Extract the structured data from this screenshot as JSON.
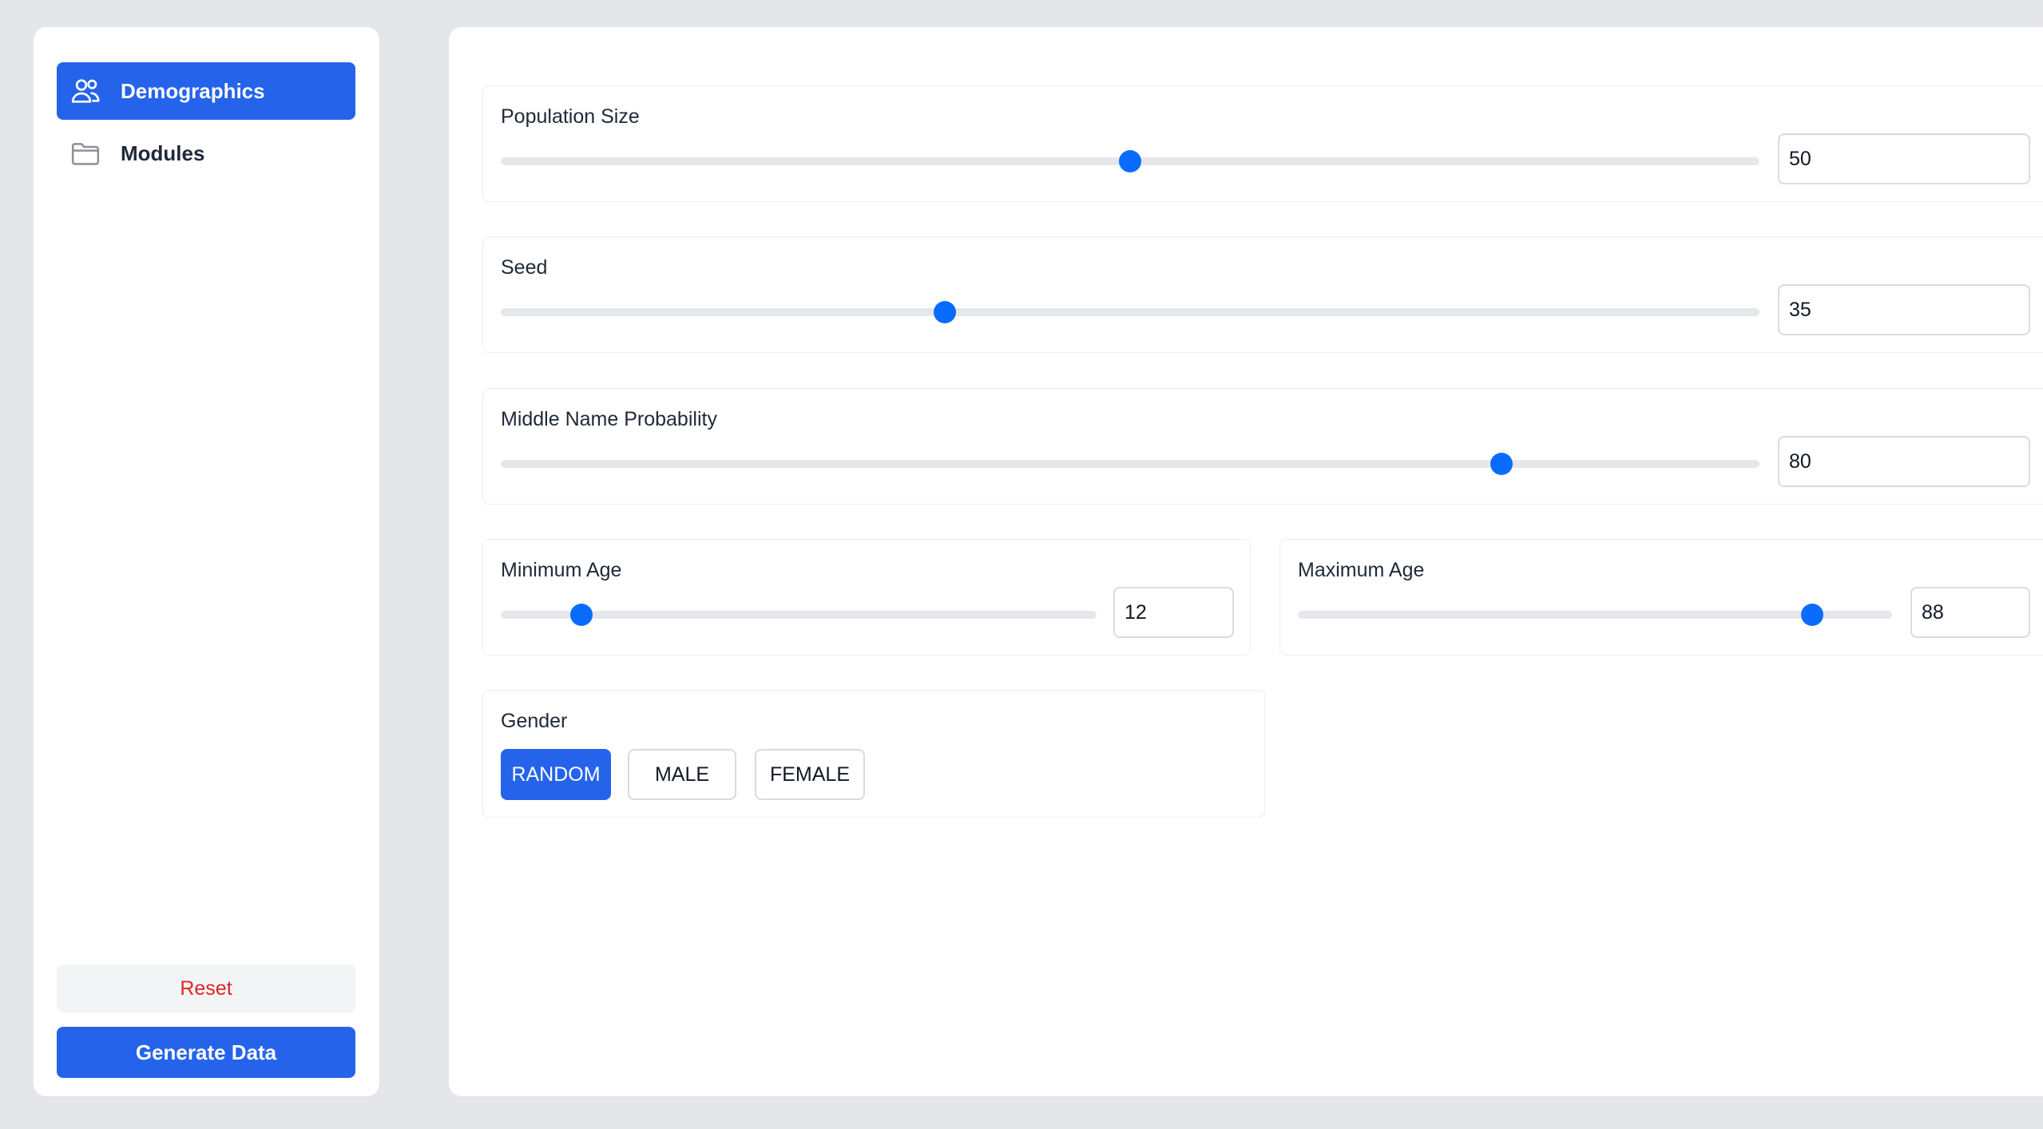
{
  "sidebar": {
    "nav": [
      {
        "label": "Demographics",
        "icon": "users-icon",
        "active": true
      },
      {
        "label": "Modules",
        "icon": "folder-icon",
        "active": false
      }
    ],
    "reset_label": "Reset",
    "generate_label": "Generate Data"
  },
  "main": {
    "population_size": {
      "label": "Population Size",
      "value": "50",
      "slider_fraction": 0.5
    },
    "seed": {
      "label": "Seed",
      "value": "35",
      "slider_fraction": 0.353
    },
    "middle_name_probability": {
      "label": "Middle Name Probability",
      "value": "80",
      "slider_fraction": 0.795
    },
    "minimum_age": {
      "label": "Minimum Age",
      "value": "12",
      "slider_fraction": 0.135
    },
    "maximum_age": {
      "label": "Maximum Age",
      "value": "88",
      "slider_fraction": 0.865
    },
    "gender": {
      "label": "Gender",
      "options": [
        "RANDOM",
        "MALE",
        "FEMALE"
      ],
      "selected": "RANDOM"
    }
  },
  "colors": {
    "accent": "#2563eb",
    "slider_thumb": "#0a6cff",
    "danger": "#dc2626",
    "background": "#e4e6ea"
  }
}
